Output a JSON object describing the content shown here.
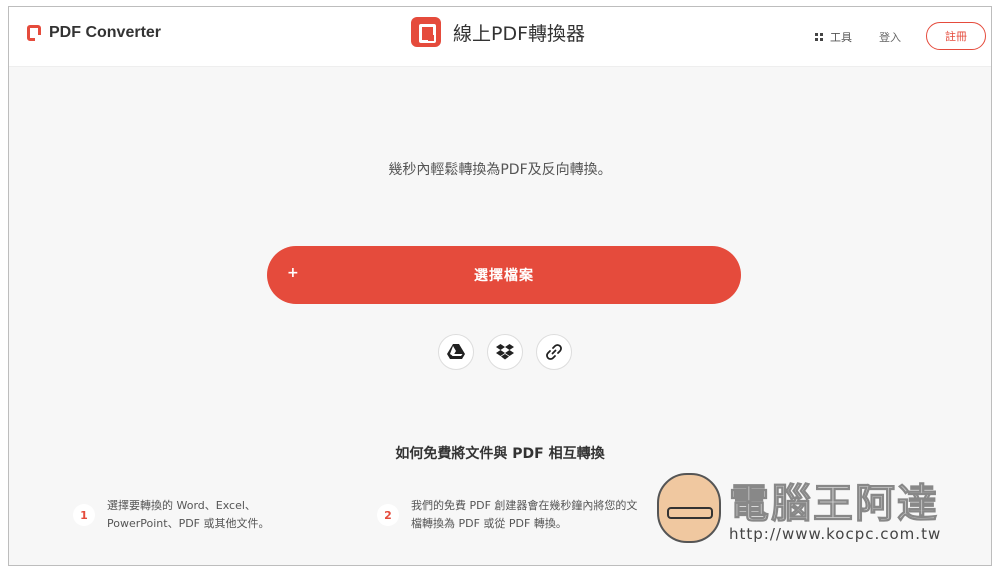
{
  "header": {
    "brand_name": "PDF Converter",
    "center_title": "線上PDF轉換器",
    "tools_label": "工具",
    "login_label": "登入",
    "register_label": "註冊"
  },
  "hero": {
    "subtitle": "幾秒內輕鬆轉換為PDF及反向轉換。",
    "upload_plus": "+",
    "upload_label": "選擇檔案"
  },
  "sources": [
    "google-drive-icon",
    "dropbox-icon",
    "link-icon"
  ],
  "howto": {
    "title": "如何免費將文件與 PDF 相互轉換",
    "steps": [
      {
        "num": "1",
        "text": "選擇要轉換的 Word、Excel、PowerPoint、PDF 或其他文件。"
      },
      {
        "num": "2",
        "text": "我們的免費 PDF 創建器會在幾秒鐘內將您的文檔轉換為 PDF 或從 PDF 轉換。"
      }
    ]
  },
  "watermark": {
    "text": "電腦王阿達",
    "url": "http://www.kocpc.com.tw"
  },
  "colors": {
    "accent": "#e54b3c"
  }
}
